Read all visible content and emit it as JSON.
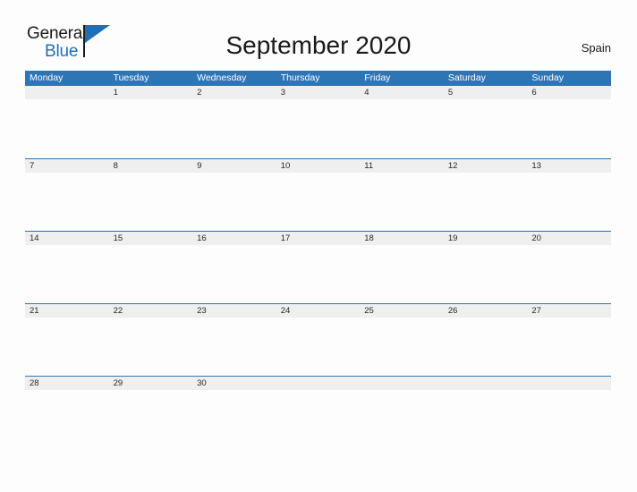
{
  "brand": {
    "name_part1": "General",
    "name_part2": "Blue",
    "color_primary": "#2e75b6",
    "color_dark": "#1a1a1a"
  },
  "header": {
    "title": "September 2020",
    "country": "Spain"
  },
  "calendar": {
    "header_bg": "#2e75b6",
    "date_band_bg": "#efefef",
    "rule_color": "#2e75b6",
    "day_names": [
      "Monday",
      "Tuesday",
      "Wednesday",
      "Thursday",
      "Friday",
      "Saturday",
      "Sunday"
    ],
    "weeks": [
      [
        "",
        "1",
        "2",
        "3",
        "4",
        "5",
        "6"
      ],
      [
        "7",
        "8",
        "9",
        "10",
        "11",
        "12",
        "13"
      ],
      [
        "14",
        "15",
        "16",
        "17",
        "18",
        "19",
        "20"
      ],
      [
        "21",
        "22",
        "23",
        "24",
        "25",
        "26",
        "27"
      ],
      [
        "28",
        "29",
        "30",
        "",
        "",
        "",
        ""
      ]
    ]
  }
}
